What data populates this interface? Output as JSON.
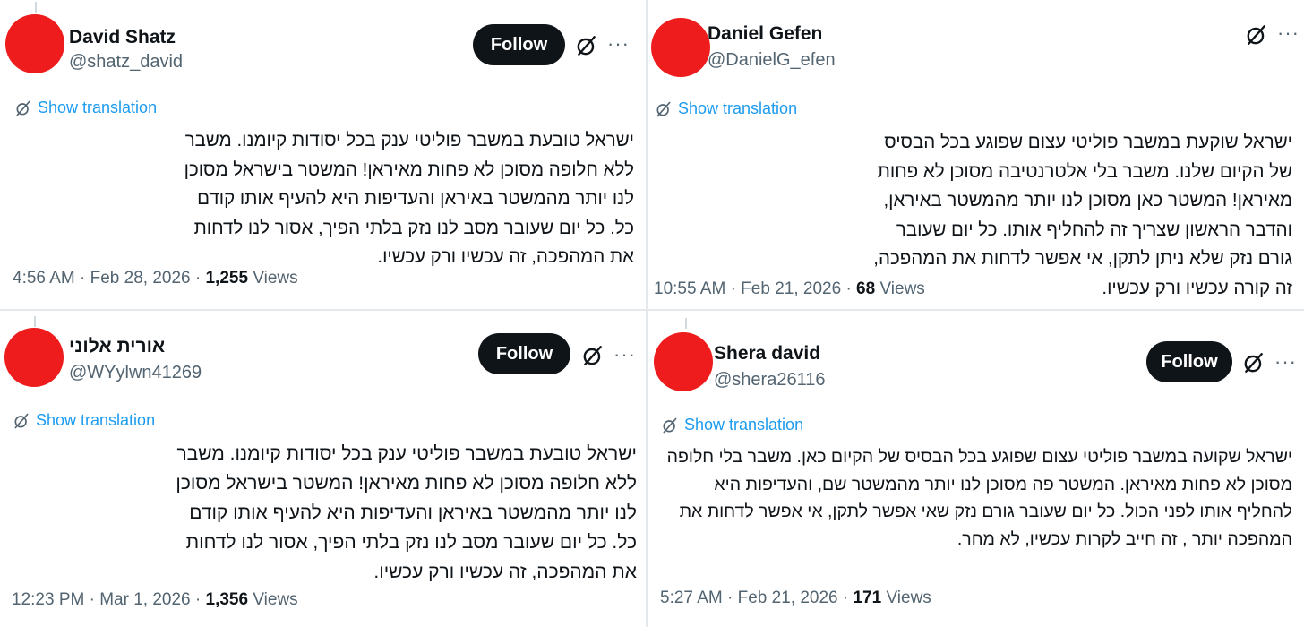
{
  "posts": [
    {
      "name": "David Shatz",
      "handle": "@shatz_david",
      "follow_label": "Follow",
      "translate_label": "Show translation",
      "body": "ישראל טובעת במשבר פוליטי ענק בכל יסודות קיומנו. משבר ללא חלופה מסוכן לא פחות מאיראן! המשטר בישראל מסוכן לנו יותר מהמשטר באיראן והעדיפות היא להעיף אותו קודם כל. כל יום שעובר מסב לנו נזק בלתי הפיך, אסור לנו לדחות את המהפכה, זה עכשיו ורק עכשיו.",
      "time": "4:56 AM",
      "date": "Feb 28, 2026",
      "views_count": "1,255",
      "views_label": "Views"
    },
    {
      "name": "Daniel Gefen",
      "handle": "@DanielG_efen",
      "follow_label": "",
      "translate_label": "Show translation",
      "body": "ישראל שוקעת במשבר פוליטי עצום שפוגע בכל הבסיס של הקיום שלנו. משבר בלי אלטרנטיבה מסוכן לא פחות מאיראן! המשטר כאן מסוכן לנו יותר מהמשטר באיראן, והדבר הראשון שצריך זה להחליף אותו. כל יום שעובר גורם נזק שלא ניתן לתקן, אי אפשר לדחות את המהפכה, זה קורה עכשיו ורק עכשיו.",
      "time": "10:55 AM",
      "date": "Feb 21, 2026",
      "views_count": "68",
      "views_label": "Views"
    },
    {
      "name": "אורית אלוני",
      "handle": "@WYylwn41269",
      "follow_label": "Follow",
      "translate_label": "Show translation",
      "body": "ישראל טובעת במשבר פוליטי ענק בכל יסודות קיומנו. משבר ללא חלופה מסוכן לא פחות מאיראן! המשטר בישראל מסוכן לנו יותר מהמשטר באיראן והעדיפות היא להעיף אותו קודם כל. כל יום שעובר מסב לנו נזק בלתי הפיך, אסור לנו לדחות את המהפכה, זה עכשיו ורק עכשיו.",
      "time": "12:23 PM",
      "date": "Mar 1, 2026",
      "views_count": "1,356",
      "views_label": "Views"
    },
    {
      "name": "Shera david",
      "handle": "@shera26116",
      "follow_label": "Follow",
      "translate_label": "Show translation",
      "body": "ישראל שקועה במשבר פוליטי עצום שפוגע בכל הבסיס של הקיום כאן. משבר בלי חלופה מסוכן לא פחות מאיראן. המשטר פה מסוכן לנו יותר מהמשטר שם, והעדיפות היא להחליף אותו לפני הכול. כל יום שעובר גורם נזק שאי אפשר לתקן, אי אפשר לדחות את המהפכה יותר , זה חייב לקרות עכשיו, לא מחר.",
      "time": "5:27 AM",
      "date": "Feb 21, 2026",
      "views_count": "171",
      "views_label": "Views"
    }
  ],
  "meta_separator": "·",
  "more_glyph": "···",
  "colors": {
    "avatar": "#ee1c1c",
    "link": "#1d9bf0",
    "follow_bg": "#0f1419",
    "secondary_text": "#536471"
  },
  "icons": {
    "grok": "grok-icon",
    "more": "more-options-icon",
    "translate": "translate-icon"
  }
}
